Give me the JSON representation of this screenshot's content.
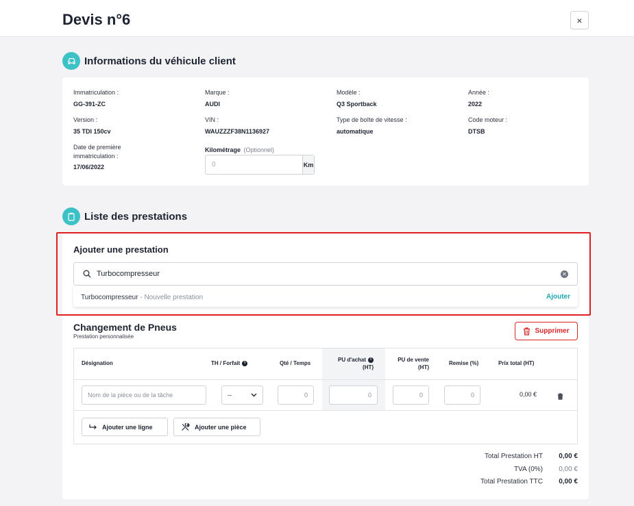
{
  "header": {
    "title": "Devis n°6",
    "close_label": "×"
  },
  "vehicle_section": {
    "title": "Informations du véhicule client",
    "fields": {
      "immat": {
        "label": "Immatriculation :",
        "value": "GG-391-ZC"
      },
      "marque": {
        "label": "Marque :",
        "value": "AUDI"
      },
      "modele": {
        "label": "Modèle :",
        "value": "Q3 Sportback"
      },
      "annee": {
        "label": "Année :",
        "value": "2022"
      },
      "version": {
        "label": "Version :",
        "value": "35 TDI 150cv"
      },
      "vin": {
        "label": "VIN :",
        "value": "WAUZZZF38N1136927"
      },
      "boite": {
        "label": "Type de boîte de vitesse :",
        "value": "automatique"
      },
      "moteur": {
        "label": "Code moteur :",
        "value": "DTSB"
      },
      "date_immat": {
        "label": "Date de première immatriculation :",
        "value": "17/06/2022"
      }
    },
    "km": {
      "label": "Kilométrage",
      "optional": "(Optionnel)",
      "placeholder": "0",
      "unit": "Km"
    }
  },
  "prestations_section": {
    "title": "Liste des prestations"
  },
  "add_prestation": {
    "title": "Ajouter une prestation",
    "search_value": "Turbocompresseur",
    "suggestion": {
      "name": "Turbocompresseur",
      "note": " - Nouvelle prestation",
      "action": "Ajouter"
    }
  },
  "prestation": {
    "title": "Changement de Pneus",
    "subtitle": "Prestation personnalisée",
    "delete_label": "Supprimer",
    "table": {
      "headers": {
        "designation": "Désignation",
        "th": "TH / Forfait",
        "qte": "Qté / Temps",
        "pu_achat_1": "PU d'achat",
        "pu_achat_2": "(HT)",
        "pu_vente_1": "PU de vente",
        "pu_vente_2": "(HT)",
        "remise": "Remise (%)",
        "prix_total": "Prix total (HT)"
      },
      "row": {
        "designation_placeholder": "Nom de la pièce ou de la tâche",
        "th_value": "--",
        "qte": "0",
        "pu_achat": "0",
        "pu_vente": "0",
        "remise": "0",
        "total": "0,00 €"
      },
      "add_line": "Ajouter une ligne",
      "add_piece": "Ajouter une pièce"
    },
    "totals": {
      "ht_label": "Total Prestation HT",
      "ht_value": "0,00 €",
      "tva_label": "TVA (0%)",
      "tva_value": "0,00 €",
      "ttc_label": "Total Prestation TTC",
      "ttc_value": "0,00 €"
    }
  },
  "colors": {
    "accent": "#3cc1c6",
    "danger": "#d72626",
    "highlight": "#e02020",
    "link": "#1fa6ad"
  }
}
